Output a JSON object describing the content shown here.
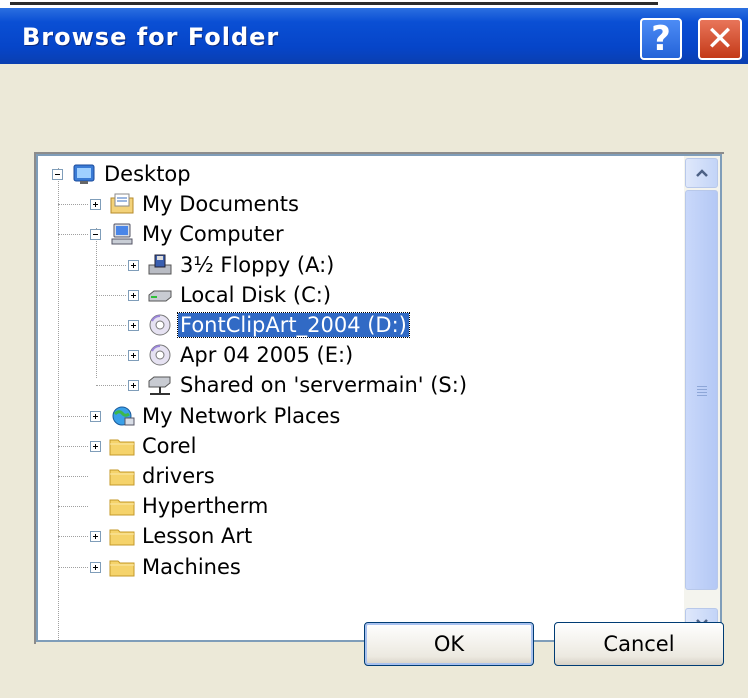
{
  "window": {
    "title": "Browse for Folder"
  },
  "title_buttons": {
    "help": "?",
    "close": "✕"
  },
  "tree": {
    "items": [
      {
        "label": "Desktop",
        "icon": "desktop-icon",
        "level": 0,
        "expander": "minus"
      },
      {
        "label": "My Documents",
        "icon": "my-documents-icon",
        "level": 1,
        "expander": "plus"
      },
      {
        "label": "My Computer",
        "icon": "my-computer-icon",
        "level": 1,
        "expander": "minus"
      },
      {
        "label": "3½ Floppy (A:)",
        "icon": "floppy-drive-icon",
        "level": 2,
        "expander": "plus"
      },
      {
        "label": "Local Disk (C:)",
        "icon": "hard-disk-icon",
        "level": 2,
        "expander": "plus"
      },
      {
        "label": "FontClipArt_2004 (D:)",
        "icon": "cd-drive-icon",
        "level": 2,
        "expander": "plus",
        "selected": true
      },
      {
        "label": "Apr 04 2005 (E:)",
        "icon": "cd-drive-icon",
        "level": 2,
        "expander": "plus"
      },
      {
        "label": "Shared on 'servermain' (S:)",
        "icon": "network-drive-icon",
        "level": 2,
        "expander": "plus"
      },
      {
        "label": "My Network Places",
        "icon": "network-places-icon",
        "level": 1,
        "expander": "plus"
      },
      {
        "label": "Corel",
        "icon": "folder-icon",
        "level": 1,
        "expander": "plus"
      },
      {
        "label": "drivers",
        "icon": "folder-icon",
        "level": 1,
        "expander": "none"
      },
      {
        "label": "Hypertherm",
        "icon": "folder-icon",
        "level": 1,
        "expander": "none"
      },
      {
        "label": "Lesson Art",
        "icon": "folder-icon",
        "level": 1,
        "expander": "plus"
      },
      {
        "label": "Machines",
        "icon": "folder-icon",
        "level": 1,
        "expander": "plus"
      }
    ]
  },
  "scrollbar": {
    "up": "⌃",
    "down": "⌄"
  },
  "buttons": {
    "ok": "OK",
    "cancel": "Cancel"
  },
  "colors": {
    "selection": "#316ac5",
    "title_bar": "#0a4fd4",
    "face": "#ece9d8"
  }
}
